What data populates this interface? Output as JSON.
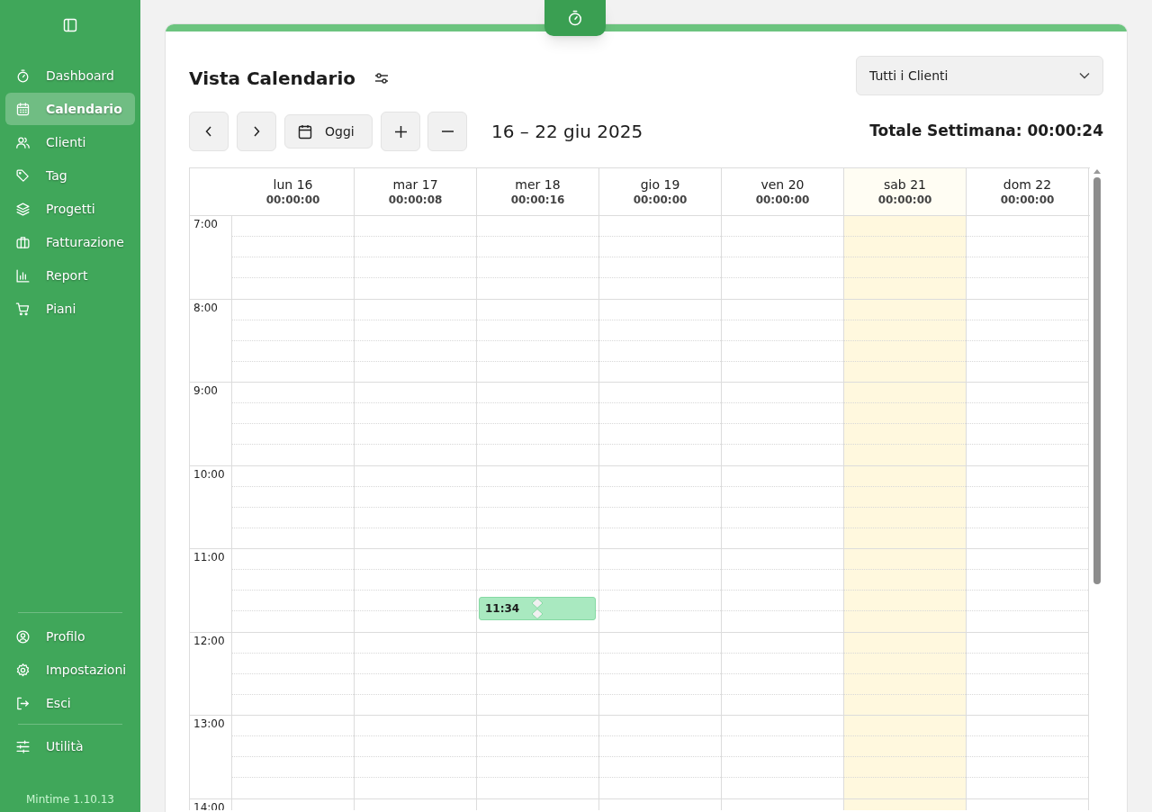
{
  "sidebar": {
    "items": [
      {
        "label": "Dashboard",
        "selected": false
      },
      {
        "label": "Calendario",
        "selected": true
      },
      {
        "label": "Clienti",
        "selected": false
      },
      {
        "label": "Tag",
        "selected": false
      },
      {
        "label": "Progetti",
        "selected": false
      },
      {
        "label": "Fatturazione",
        "selected": false
      },
      {
        "label": "Report",
        "selected": false
      },
      {
        "label": "Piani",
        "selected": false
      }
    ],
    "bottom_items": [
      {
        "label": "Profilo",
        "selected": false
      },
      {
        "label": "Impostazioni",
        "selected": false
      },
      {
        "label": "Esci",
        "selected": false
      }
    ],
    "utility_item": {
      "label": "Utilità",
      "selected": false
    },
    "version": "Mintime 1.10.13"
  },
  "header": {
    "title": "Vista Calendario",
    "client_filter": "Tutti i Clienti"
  },
  "toolbar": {
    "today_button": "Oggi",
    "range": "16 – 22 giu 2025",
    "week_total": "Totale Settimana: 00:00:24"
  },
  "calendar": {
    "hours": [
      "7:00",
      "8:00",
      "9:00",
      "10:00",
      "11:00",
      "12:00",
      "13:00",
      "14:00"
    ],
    "days": [
      {
        "label": "lun 16",
        "total": "00:00:00",
        "highlighted": false
      },
      {
        "label": "mar 17",
        "total": "00:00:08",
        "highlighted": false
      },
      {
        "label": "mer 18",
        "total": "00:00:16",
        "highlighted": false,
        "events": [
          {
            "time": "11:34"
          }
        ]
      },
      {
        "label": "gio 19",
        "total": "00:00:00",
        "highlighted": false
      },
      {
        "label": "ven 20",
        "total": "00:00:00",
        "highlighted": false
      },
      {
        "label": "sab 21",
        "total": "00:00:00",
        "highlighted": true
      },
      {
        "label": "dom 22",
        "total": "00:00:00",
        "highlighted": false
      }
    ]
  }
}
